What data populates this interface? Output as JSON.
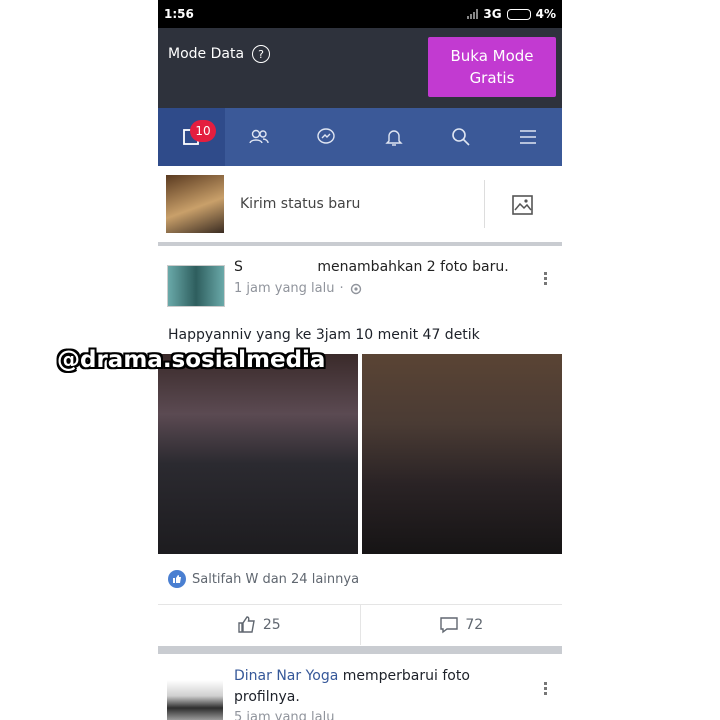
{
  "status_bar": {
    "time": "1:56",
    "network": "3G",
    "battery": "4%"
  },
  "data_bar": {
    "label": "Mode Data",
    "button": "Buka Mode Gratis"
  },
  "nav": {
    "tabs": [
      "feed-icon",
      "friends-icon",
      "messenger-icon",
      "notifications-icon",
      "search-icon",
      "menu-icon"
    ],
    "badge": "10"
  },
  "compose": {
    "placeholder": "Kirim status baru"
  },
  "post": {
    "author_prefix": "S",
    "action": "menambahkan 2 foto baru.",
    "time": "1 jam yang lalu",
    "text": "Happyanniv yang ke 3jam 10 menit 47 detik",
    "reactions": "Saltifah W dan 24 lainnya",
    "likes": "25",
    "comments": "72"
  },
  "post2": {
    "name": "Dinar Nar Yoga",
    "action": "memperbarui foto profilnya.",
    "time": "5 jam yang lalu"
  },
  "watermark": "@drama.sosialmedia",
  "colors": {
    "nav": "#3b5998",
    "data_bar": "#2e323c",
    "free_button": "#c23ad1",
    "badge": "#e41e3f"
  }
}
